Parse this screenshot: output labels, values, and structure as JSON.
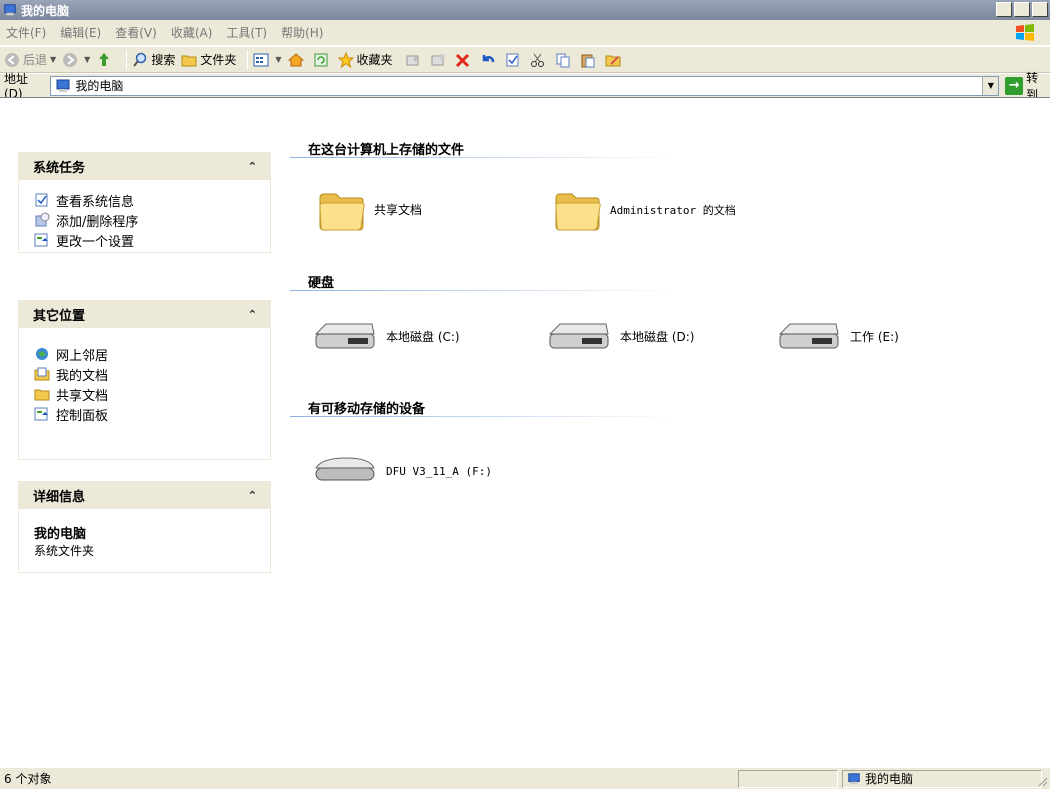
{
  "window": {
    "title": "我的电脑",
    "title_icon": "my-computer-icon"
  },
  "window_buttons": [
    {
      "name": "minimize",
      "label": ""
    },
    {
      "name": "maximize",
      "label": ""
    },
    {
      "name": "close",
      "label": ""
    }
  ],
  "menubar": {
    "items": [
      "文件(F)",
      "编辑(E)",
      "查看(V)",
      "收藏(A)",
      "工具(T)",
      "帮助(H)"
    ],
    "logo": "windows-logo-icon"
  },
  "toolbar": {
    "back": "后退",
    "search": "搜索",
    "folders": "文件夹",
    "favorites": "收藏夹"
  },
  "addressbar": {
    "label": "地址(D)",
    "value": "我的电脑",
    "go": "转到"
  },
  "taskpane": {
    "system_tasks": {
      "title": "系统任务",
      "items": [
        "查看系统信息",
        "添加/删除程序",
        "更改一个设置"
      ]
    },
    "other_places": {
      "title": "其它位置",
      "items": [
        "网上邻居",
        "我的文档",
        "共享文档",
        "控制面板"
      ]
    },
    "details": {
      "title": "详细信息",
      "name": "我的电脑",
      "type": "系统文件夹"
    }
  },
  "groups": {
    "files": {
      "title": "在这台计算机上存储的文件",
      "items": [
        "共享文档",
        "Administrator 的文档"
      ]
    },
    "hard_disks": {
      "title": "硬盘",
      "items": [
        "本地磁盘 (C:)",
        "本地磁盘 (D:)",
        "工作 (E:)"
      ]
    },
    "removable": {
      "title": "有可移动存储的设备",
      "items": [
        "DFU V3_11_A (F:)"
      ]
    }
  },
  "statusbar": {
    "count": "6 个对象",
    "location": "我的电脑"
  }
}
